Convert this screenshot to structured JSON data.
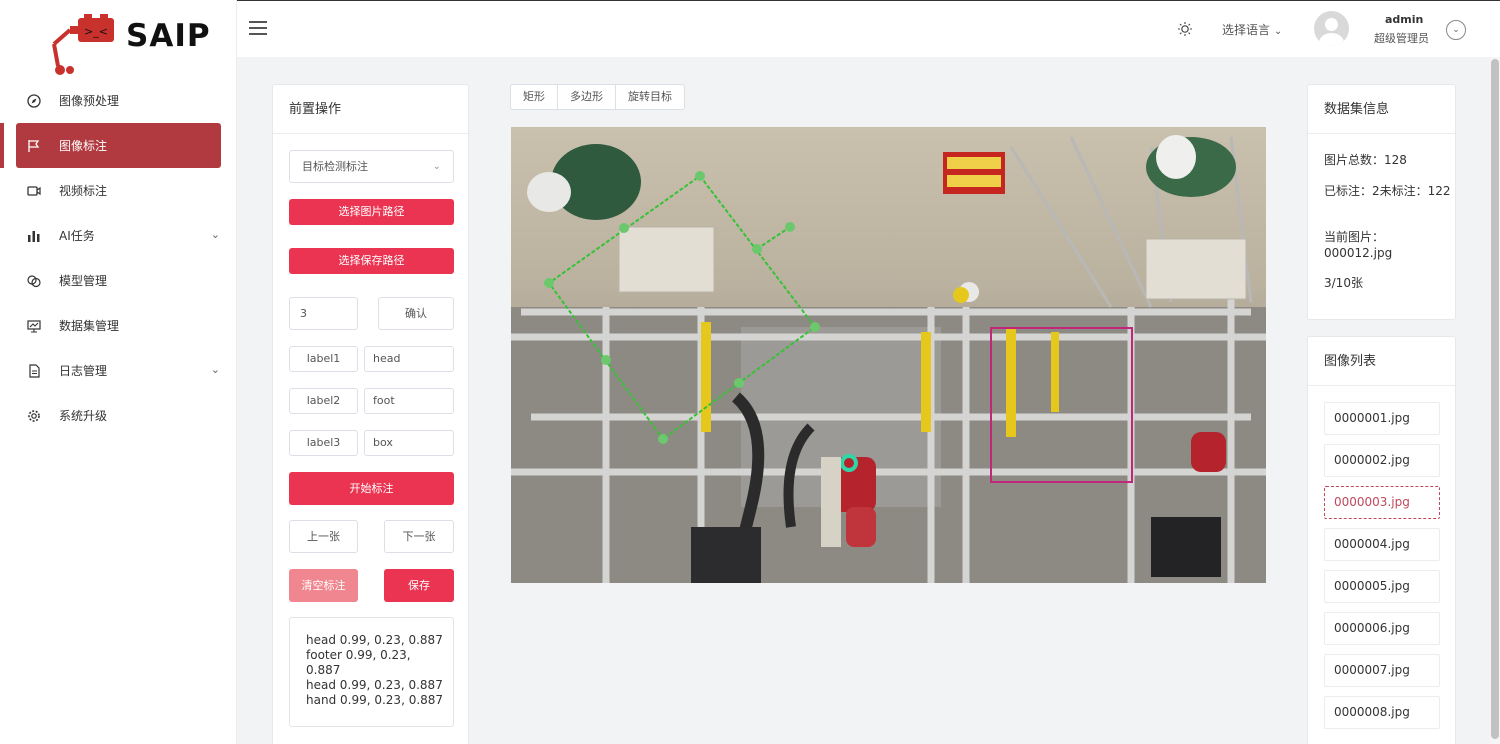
{
  "app": {
    "logo_text": "SAIP"
  },
  "sidebar": {
    "items": [
      {
        "label": "图像预处理",
        "icon": "compass-icon"
      },
      {
        "label": "图像标注",
        "icon": "flag-icon",
        "active": true
      },
      {
        "label": "视频标注",
        "icon": "video-icon"
      },
      {
        "label": "AI任务",
        "icon": "bar-chart-icon",
        "expandable": true
      },
      {
        "label": "模型管理",
        "icon": "layers-icon"
      },
      {
        "label": "数据集管理",
        "icon": "presentation-icon"
      },
      {
        "label": "日志管理",
        "icon": "document-icon",
        "expandable": true
      },
      {
        "label": "系统升级",
        "icon": "gear-icon"
      }
    ]
  },
  "header": {
    "language_label": "选择语言",
    "user_name": "admin",
    "user_role": "超级管理员"
  },
  "left_panel": {
    "title": "前置操作",
    "task_select": "目标检测标注",
    "select_image_path": "选择图片路径",
    "select_save_path": "选择保存路径",
    "count_value": "3",
    "confirm": "确认",
    "labels": [
      {
        "name": "label1",
        "value": "head"
      },
      {
        "name": "label2",
        "value": "foot"
      },
      {
        "name": "label3",
        "value": "box"
      }
    ],
    "start": "开始标注",
    "prev": "上一张",
    "next": "下一张",
    "clear": "清空标注",
    "save": "保存",
    "results": [
      "head 0.99, 0.23, 0.887",
      "footer 0.99, 0.23, 0.887",
      "head 0.99, 0.23, 0.887",
      "hand 0.99, 0.23, 0.887"
    ]
  },
  "tools": [
    "矩形",
    "多边形",
    "旋转目标"
  ],
  "dataset_info": {
    "title": "数据集信息",
    "total": "图片总数：128",
    "labeled": "已标注：2未标注：122",
    "current": "当前图片：000012.jpg",
    "progress": "3/10张"
  },
  "image_list": {
    "title": "图像列表",
    "files": [
      "0000001.jpg",
      "0000002.jpg",
      "0000003.jpg",
      "0000004.jpg",
      "0000005.jpg",
      "0000006.jpg",
      "0000007.jpg",
      "0000008.jpg"
    ],
    "active_index": 2
  },
  "colors": {
    "accent": "#ea3451",
    "sidebar_active": "#b03a3f",
    "annotation_green": "#35c235",
    "annotation_magenta": "#c0267a"
  }
}
